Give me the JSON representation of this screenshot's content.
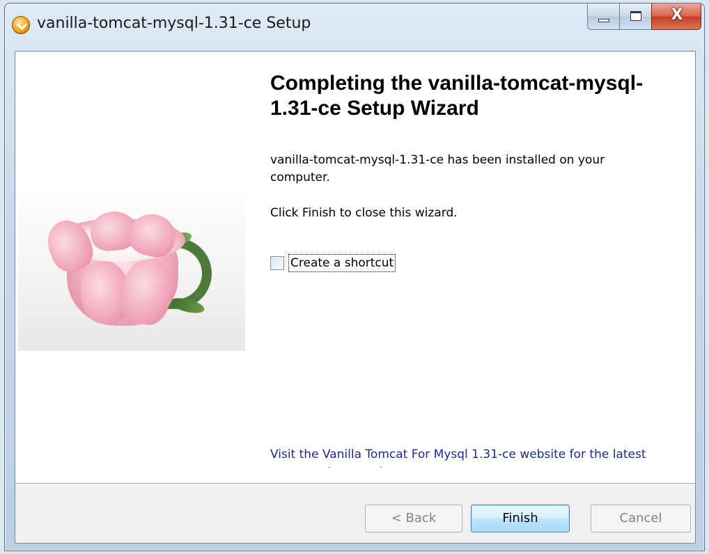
{
  "window": {
    "title": "vanilla-tomcat-mysql-1.31-ce Setup",
    "icon": "installer-icon",
    "controls": {
      "close_glyph": "X"
    }
  },
  "wizard": {
    "heading": "Completing the vanilla-tomcat-mysql-1.31-ce Setup Wizard",
    "installed_text": "vanilla-tomcat-mysql-1.31-ce has been installed on your computer.",
    "instruction_text": "Click Finish to close this wizard.",
    "shortcut_checkbox": {
      "label": "Create a shortcut",
      "checked": false
    },
    "link_text": "Visit the Vanilla Tomcat For Mysql 1.31-ce website for the latest news, updates and support"
  },
  "buttons": {
    "back": "< Back",
    "finish": "Finish",
    "cancel": "Cancel"
  }
}
